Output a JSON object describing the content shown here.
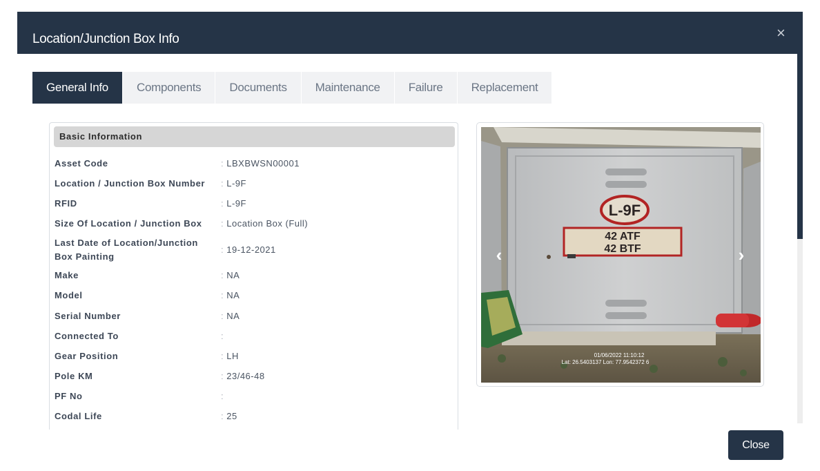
{
  "modal": {
    "title": "Location/Junction Box Info",
    "close_icon": "×",
    "close_button": "Close"
  },
  "tabs": [
    {
      "label": "General Info",
      "active": true
    },
    {
      "label": "Components",
      "active": false
    },
    {
      "label": "Documents",
      "active": false
    },
    {
      "label": "Maintenance",
      "active": false
    },
    {
      "label": "Failure",
      "active": false
    },
    {
      "label": "Replacement",
      "active": false
    }
  ],
  "basic_info": {
    "title": "Basic Information",
    "separator": ":",
    "rows": [
      {
        "label": "Asset Code",
        "value": "LBXBWSN00001"
      },
      {
        "label": "Location / Junction Box Number",
        "value": "L-9F"
      },
      {
        "label": "RFID",
        "value": "L-9F"
      },
      {
        "label": "Size Of Location / Junction Box",
        "value": "Location Box (Full)"
      },
      {
        "label": "Last Date of Location/Junction Box Painting",
        "value": "19-12-2021"
      },
      {
        "label": "Make",
        "value": "NA"
      },
      {
        "label": "Model",
        "value": "NA"
      },
      {
        "label": "Serial Number",
        "value": "NA"
      },
      {
        "label": "Connected To",
        "value": ""
      },
      {
        "label": "Gear Position",
        "value": "LH"
      },
      {
        "label": "Pole KM",
        "value": "23/46-48"
      },
      {
        "label": "PF No",
        "value": ""
      },
      {
        "label": "Codal Life",
        "value": "25"
      }
    ]
  },
  "photo": {
    "box_label": "L-9F",
    "plate_line1": "42 ATF",
    "plate_line2": "42 BTF",
    "timestamp": "01/06/2022 11:10:12",
    "coords": "Lat: 26.5403137 Lon: 77.9542372 6",
    "prev_icon": "‹",
    "next_icon": "›"
  },
  "colors": {
    "header_bg": "#253447",
    "tab_active_bg": "#253447",
    "tab_inactive_bg": "#f1f2f4",
    "section_title_bg": "#d6d6d6",
    "close_button_bg": "#253447"
  }
}
